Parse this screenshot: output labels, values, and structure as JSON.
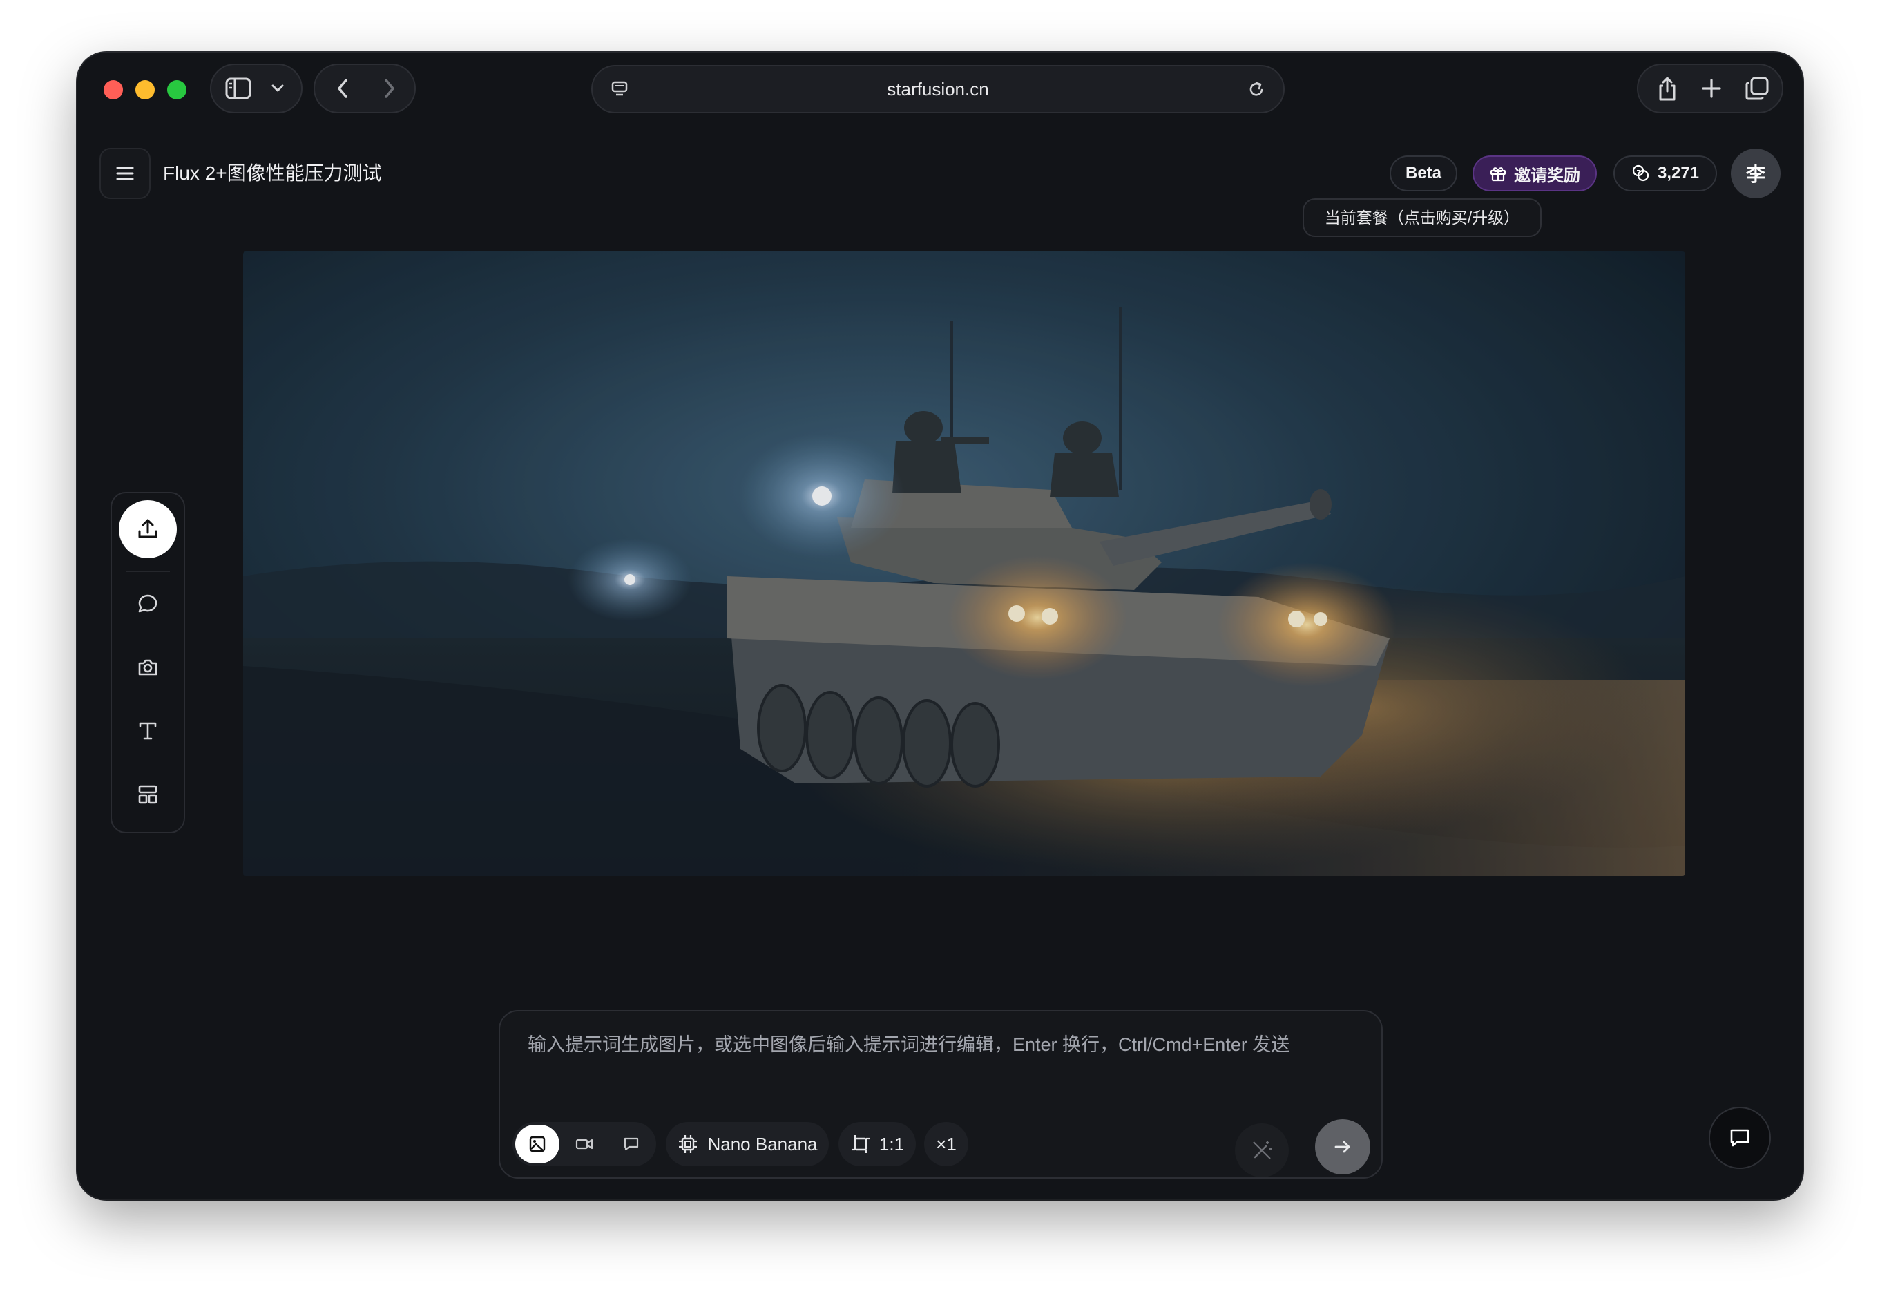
{
  "browser": {
    "url": "starfusion.cn",
    "icons": [
      "sidebar-icon",
      "chevron-down-icon",
      "back-icon",
      "forward-icon",
      "page-icon",
      "reload-icon",
      "share-icon",
      "new-tab-icon",
      "tabs-overview-icon"
    ]
  },
  "header": {
    "title": "Flux 2+图像性能压力测试",
    "beta_label": "Beta",
    "invite_label": "邀请奖励",
    "credits": "3,271",
    "avatar_initial": "李",
    "tooltip": "当前套餐（点击购买/升级）"
  },
  "toolbar": {
    "tools": [
      "upload-icon",
      "chat-bubble-icon",
      "camera-icon",
      "text-icon",
      "layout-icon"
    ]
  },
  "prompt": {
    "placeholder": "输入提示词生成图片，或选中图像后输入提示词进行编辑，Enter 换行，Ctrl/Cmd+Enter 发送",
    "modes": [
      "image-mode-icon",
      "video-mode-icon",
      "chat-mode-icon"
    ],
    "active_mode": "image",
    "model": "Nano Banana",
    "aspect_ratio": "1:1",
    "count": "×1"
  },
  "colors": {
    "window_bg": "#121418",
    "invite_bg": "#3a1f57",
    "accent_white": "#ffffff"
  }
}
